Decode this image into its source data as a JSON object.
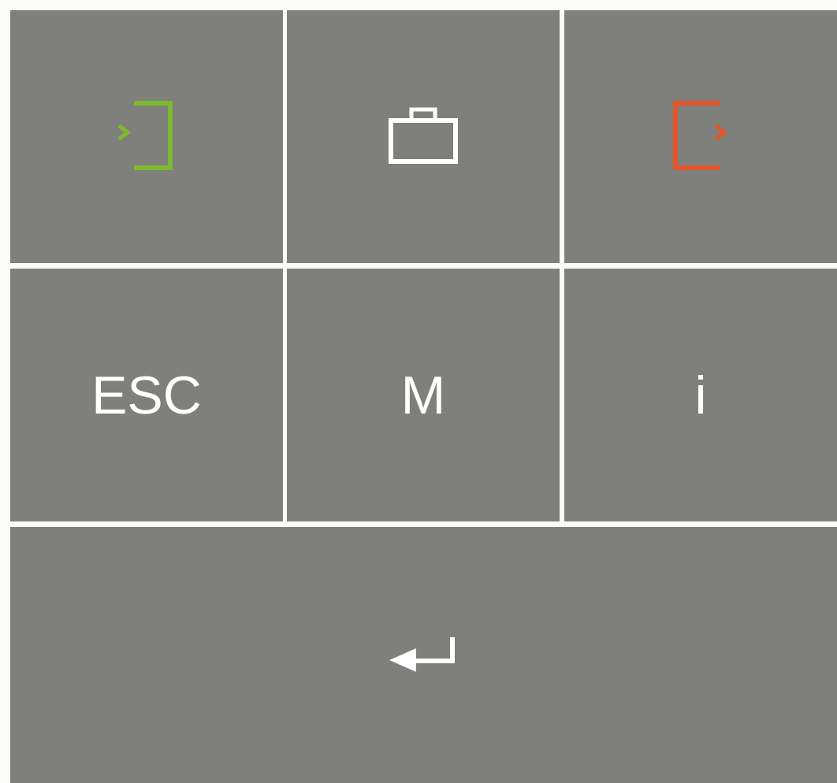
{
  "keypad": {
    "colors": {
      "key_background": "#7f807b",
      "divider": "#fbfbf8",
      "label": "#ffffff",
      "sign_in": "#7cba2f",
      "sign_out": "#e3562a",
      "briefcase": "#ffffff"
    },
    "row1": [
      {
        "icon": "sign-in-icon"
      },
      {
        "icon": "briefcase-icon"
      },
      {
        "icon": "sign-out-icon"
      }
    ],
    "row2": [
      {
        "label": "ESC"
      },
      {
        "label": "M"
      },
      {
        "label": "i"
      }
    ],
    "row3": [
      {
        "icon": "enter-icon"
      }
    ]
  }
}
